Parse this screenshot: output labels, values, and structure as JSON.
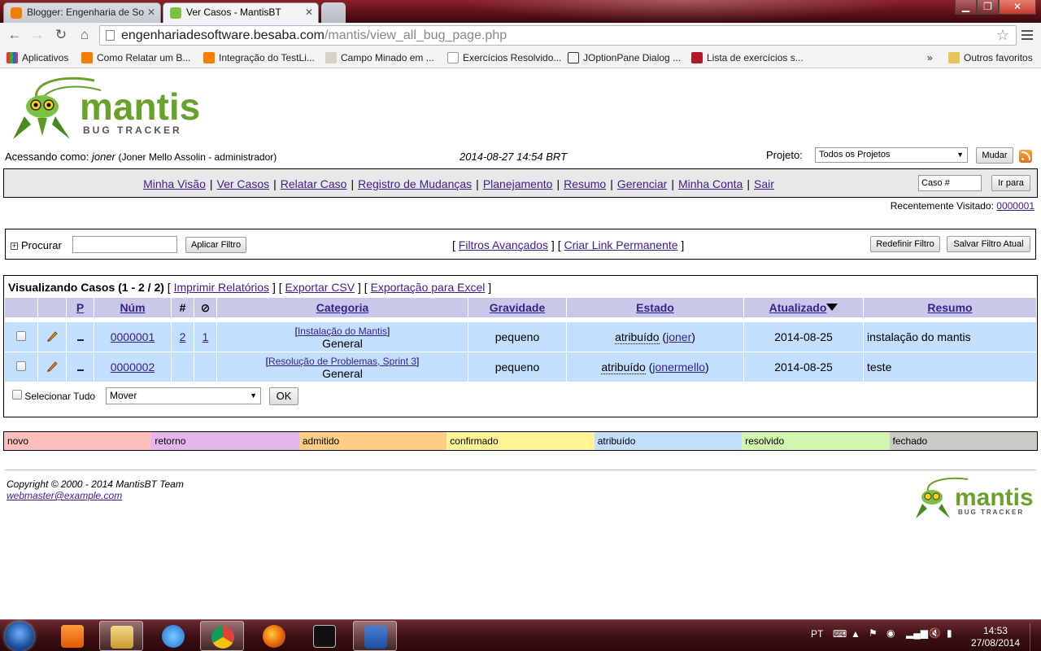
{
  "browser": {
    "tabs": [
      {
        "title": "Blogger: Engenharia de So",
        "active": false
      },
      {
        "title": "Ver Casos - MantisBT",
        "active": true
      }
    ],
    "url_host": "engenhariadesoftware.besaba.com",
    "url_path": "/mantis/view_all_bug_page.php",
    "bookmarks": [
      "Aplicativos",
      "Como Relatar um B...",
      "Integração do TestLi...",
      "Campo Minado em ...",
      "Exercícios Resolvido...",
      "JOptionPane Dialog ...",
      "Lista de exercícios s..."
    ],
    "bookmarks_overflow": "»",
    "other_bookmarks": "Outros favoritos"
  },
  "header": {
    "login_prefix": "Acessando como:",
    "username": "joner",
    "user_detail": "(Joner Mello Assolin - administrador)",
    "datetime": "2014-08-27 14:54 BRT",
    "project_label": "Projeto:",
    "project_selected": "Todos os Projetos",
    "change_button": "Mudar"
  },
  "menu": {
    "links": [
      "Minha Visão",
      "Ver Casos",
      "Relatar Caso",
      "Registro de Mudanças",
      "Planejamento",
      "Resumo",
      "Gerenciar",
      "Minha Conta",
      "Sair"
    ],
    "jump_placeholder": "Caso #",
    "jump_button": "Ir para"
  },
  "recent": {
    "label": "Recentemente Visitado:",
    "bug": "0000001"
  },
  "filter": {
    "search_label": "Procurar",
    "apply_button": "Aplicar Filtro",
    "advanced_link": "Filtros Avançados",
    "permalink": "Criar Link Permanente",
    "reset_button": "Redefinir Filtro",
    "save_button": "Salvar Filtro Atual"
  },
  "bugs": {
    "title": "Visualizando Casos (1 - 2 / 2)",
    "print_link": "Imprimir Relatórios",
    "csv_link": "Exportar CSV",
    "excel_link": "Exportação para Excel",
    "columns": [
      "P",
      "Núm",
      "#",
      "Categoria",
      "Gravidade",
      "Estado",
      "Atualizado",
      "Resumo"
    ],
    "rows": [
      {
        "id": "0000001",
        "notes": "2",
        "files": "1",
        "project": "Instalação do Mantis",
        "category": "General",
        "severity": "pequeno",
        "status": "atribuído",
        "handler": "joner",
        "updated": "2014-08-25",
        "summary": "instalação do mantis"
      },
      {
        "id": "0000002",
        "notes": "",
        "files": "",
        "project": "Resolução de Problemas, Sprint 3",
        "category": "General",
        "severity": "pequeno",
        "status": "atribuído",
        "handler": "jonermello",
        "updated": "2014-08-25",
        "summary": "teste"
      }
    ],
    "select_all": "Selecionar Tudo",
    "action_selected": "Mover",
    "ok_button": "OK"
  },
  "status_legend": [
    {
      "label": "novo",
      "color": "#fcbdbd"
    },
    {
      "label": "retorno",
      "color": "#e3b7eb"
    },
    {
      "label": "admitido",
      "color": "#ffcd85"
    },
    {
      "label": "confirmado",
      "color": "#fff494"
    },
    {
      "label": "atribuído",
      "color": "#c2dfff"
    },
    {
      "label": "resolvido",
      "color": "#d2f5b0"
    },
    {
      "label": "fechado",
      "color": "#c9ccc4"
    }
  ],
  "footer": {
    "copyright": "Copyright © 2000 - 2014 MantisBT Team",
    "email": "webmaster@example.com"
  },
  "logo": {
    "word": "mantis",
    "sub": "BUG TRACKER"
  },
  "taskbar": {
    "lang": "PT",
    "time": "14:53",
    "date": "27/08/2014"
  }
}
